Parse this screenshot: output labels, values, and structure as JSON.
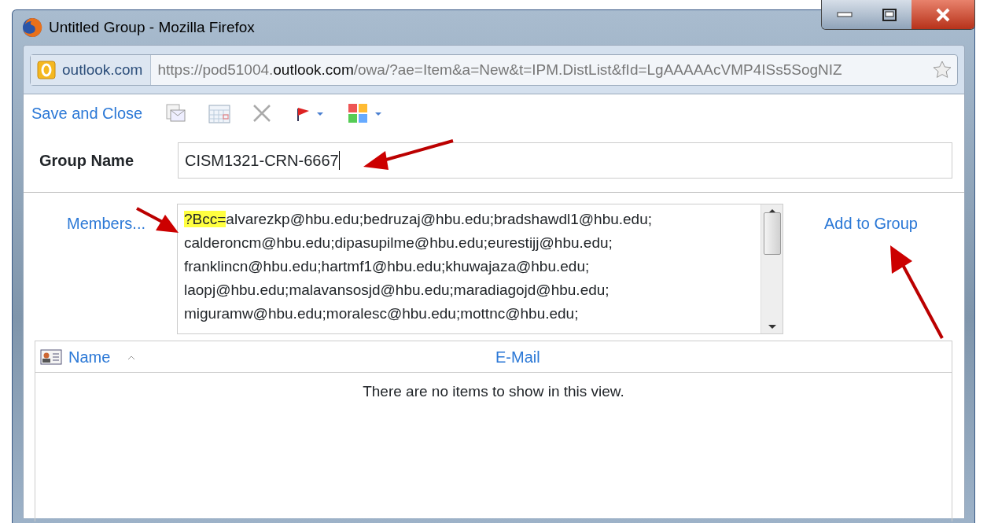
{
  "window": {
    "title": "Untitled Group - Mozilla Firefox"
  },
  "address_bar": {
    "site_label": "outlook.com",
    "url_prefix": "https://pod51004.",
    "url_domain": "outlook.com",
    "url_suffix": "/owa/?ae=Item&a=New&t=IPM.DistList&fId=LgAAAAAcVMP4ISs5SogNIZ"
  },
  "toolbar": {
    "save_label": "Save and Close"
  },
  "group_name": {
    "label": "Group Name",
    "value": "CISM1321-CRN-6667"
  },
  "members": {
    "link": "Members...",
    "highlighted": "?Bcc=",
    "lines": [
      "alvarezkp@hbu.edu;bedruzaj@hbu.edu;bradshawdl1@hbu.edu;",
      "calderoncm@hbu.edu;dipasupilme@hbu.edu;eurestijj@hbu.edu;",
      "franklincn@hbu.edu;hartmf1@hbu.edu;khuwajaza@hbu.edu;",
      "laopj@hbu.edu;malavansosjd@hbu.edu;maradiagojd@hbu.edu;",
      "miguramw@hbu.edu;moralesc@hbu.edu;mottnc@hbu.edu;"
    ],
    "add_link": "Add to Group"
  },
  "table": {
    "columns": [
      "Name",
      "E-Mail"
    ],
    "empty_message": "There are no items to show in this view."
  }
}
